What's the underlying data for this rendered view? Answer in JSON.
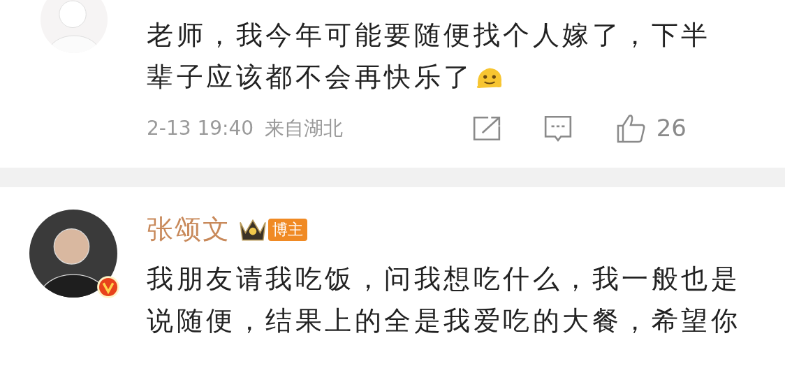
{
  "comments": [
    {
      "body": "老师，我今年可能要随便找个人嫁了，下半辈子应该都不会再快乐了",
      "emoji": true,
      "time": "2-13 19:40",
      "location": "来自湖北",
      "likes": "26"
    },
    {
      "name": "张颂文",
      "badge": "博主",
      "verified": true,
      "body": "我朋友请我吃饭，问我想吃什么，我一般也是说随便，结果上的全是我爱吃的大餐，希望你"
    }
  ]
}
